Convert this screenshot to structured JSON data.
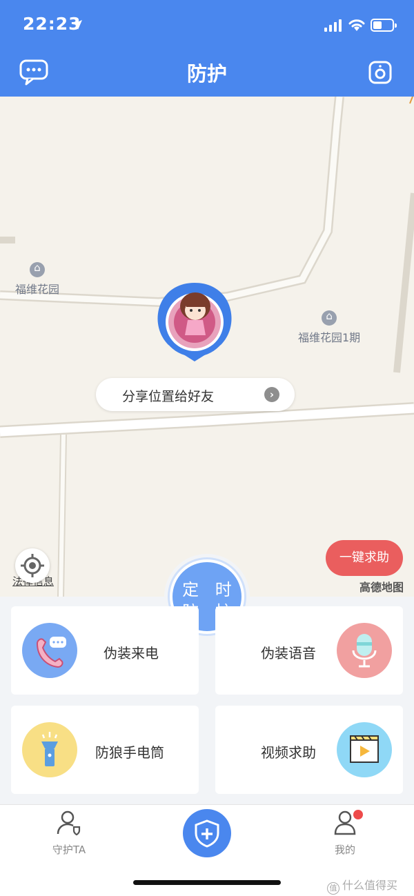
{
  "status_bar": {
    "time": "22:23",
    "battery_level": 0.45
  },
  "header": {
    "title": "防护",
    "message_icon": "chat-bubble-icon",
    "camera_icon": "camera-icon"
  },
  "map": {
    "pois": [
      {
        "label": "福维花园"
      },
      {
        "label": "福维花园1期"
      }
    ],
    "share_label": "分享位置给好友",
    "legal_text": "法律信息",
    "sos_label": "一键求助",
    "provider": "高德地图"
  },
  "timer": {
    "line1": "定 时",
    "line2": "防 护"
  },
  "cards": [
    {
      "label": "伪装来电",
      "icon": "phone-call-icon",
      "color": "#79a9f3"
    },
    {
      "label": "伪装语音",
      "icon": "microphone-icon",
      "color": "#f1a0a0"
    },
    {
      "label": "防狼手电筒",
      "icon": "flashlight-icon",
      "color": "#f8df85"
    },
    {
      "label": "视频求助",
      "icon": "video-clapper-icon",
      "color": "#8fd8f6"
    }
  ],
  "tabbar": {
    "tabs": [
      {
        "label": "守护TA",
        "icon": "guard-person-icon"
      },
      {
        "label": "",
        "icon": "shield-plus-icon"
      },
      {
        "label": "我的",
        "icon": "user-icon"
      }
    ]
  },
  "watermark": "什么值得买"
}
